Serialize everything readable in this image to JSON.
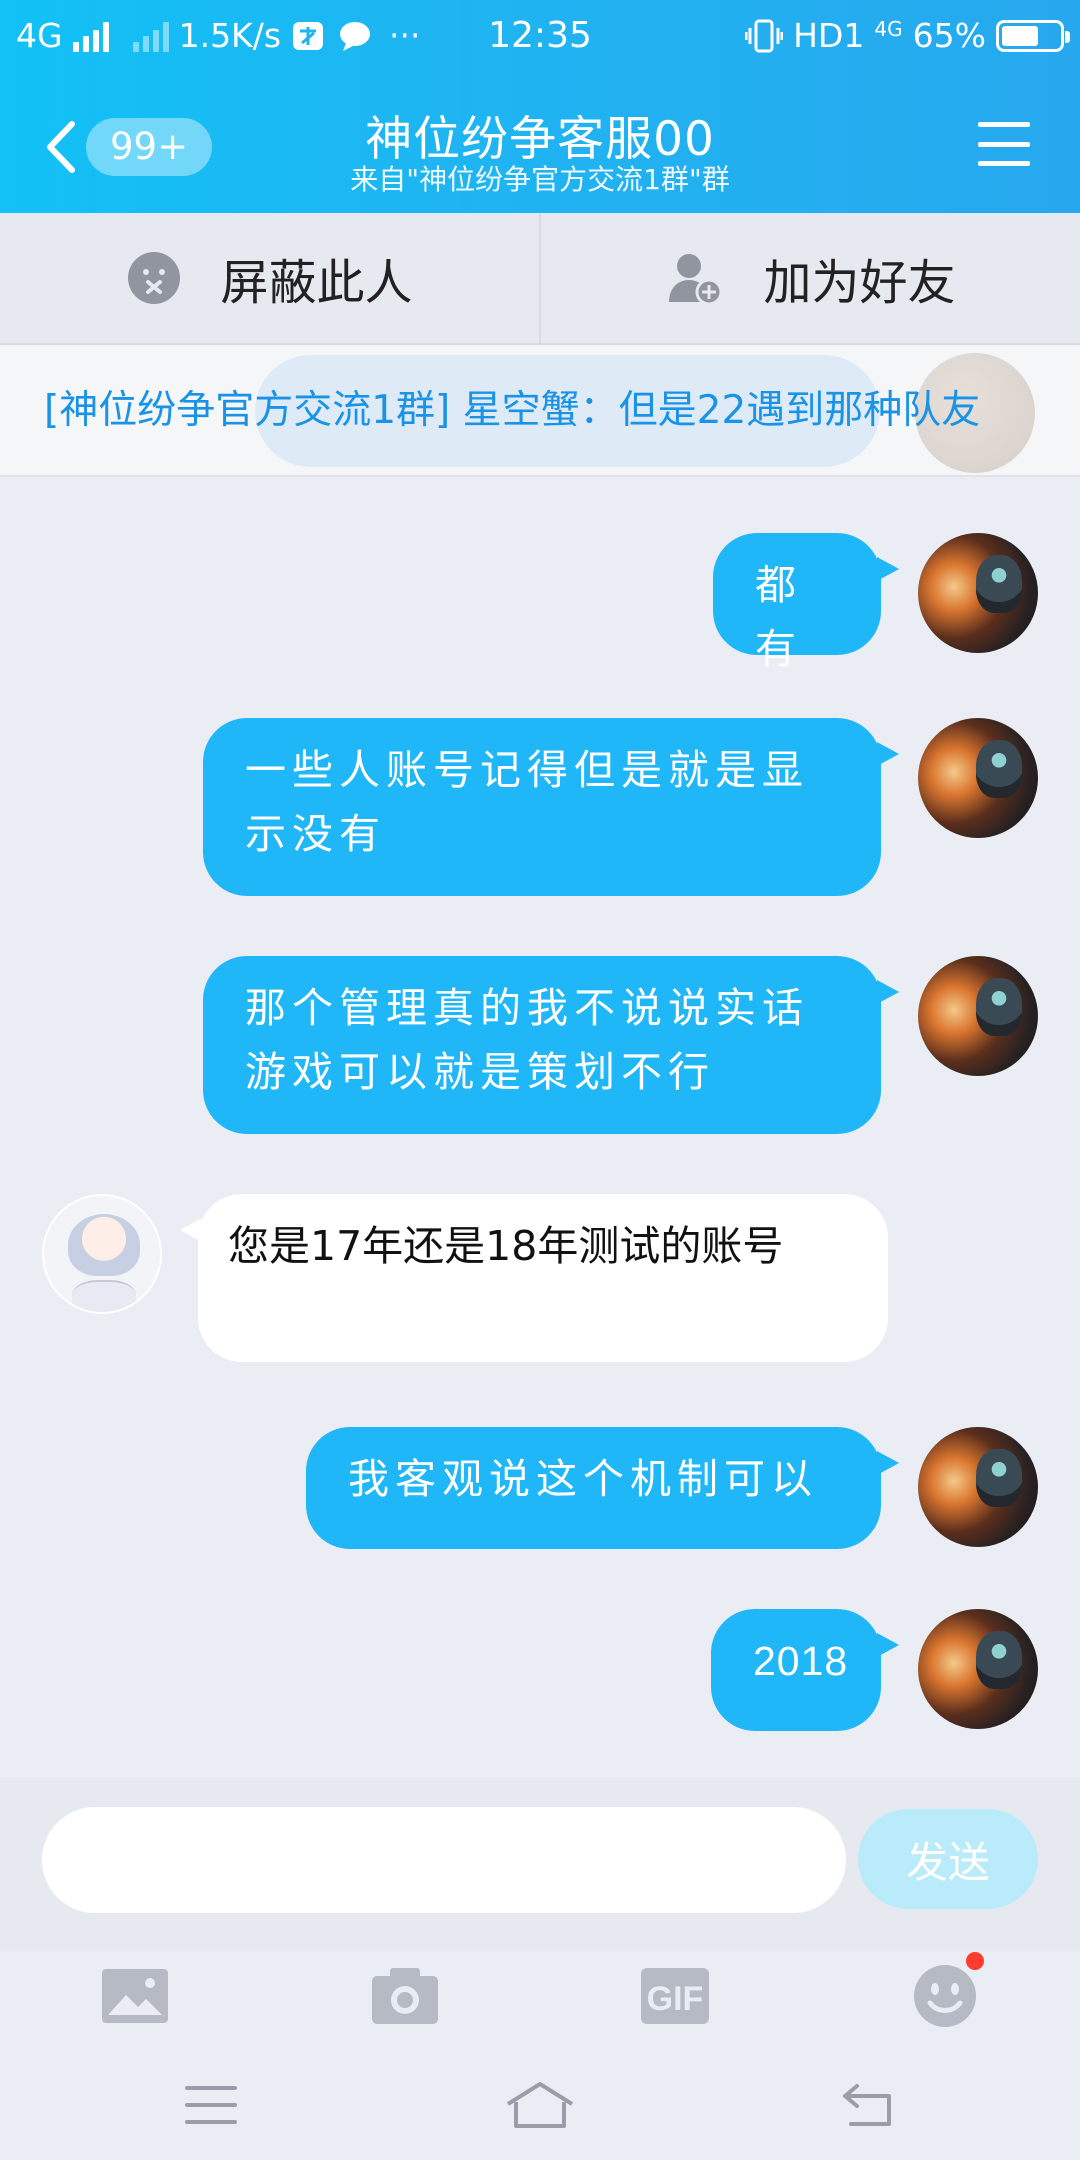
{
  "status_bar": {
    "network": "4G",
    "speed": "1.5K/s",
    "time": "12:35",
    "hd": "HD1",
    "network2": "4G",
    "battery": "65%",
    "battery_level": 0.65,
    "more": "···"
  },
  "header": {
    "unread_badge": "99+",
    "title": "神位纷争客服00",
    "subtitle": "来自\"神位纷争官方交流1群\"群"
  },
  "actions": {
    "block_label": "屏蔽此人",
    "add_friend_label": "加为好友"
  },
  "notice": {
    "text": "[神位纷争官方交流1群] 星空蟹：但是22遇到那种队友"
  },
  "messages": [
    {
      "side": "out",
      "text": "都有"
    },
    {
      "side": "out",
      "text": "一些人账号记得但是就是显示没有"
    },
    {
      "side": "out",
      "text": "那个管理真的我不说说实话游戏可以就是策划不行"
    },
    {
      "side": "in",
      "text": "您是17年还是18年测试的账号"
    },
    {
      "side": "out",
      "text": "我客观说这个机制可以"
    },
    {
      "side": "out",
      "text": "2018"
    }
  ],
  "input": {
    "placeholder": "",
    "value": "",
    "send_label": "发送"
  },
  "toolbar": {
    "icons": [
      "image-icon",
      "camera-icon",
      "gif-icon",
      "emoji-icon"
    ],
    "gif_label": "GIF"
  },
  "colors": {
    "header_gradient_start": "#12c1f6",
    "header_gradient_end": "#27a8ee",
    "outgoing_bubble": "#1fb7f7",
    "incoming_bubble": "#ffffff",
    "notice_text": "#1a93e6",
    "send_button": "#b9ebfb",
    "badge_dot": "#ff3b30"
  }
}
